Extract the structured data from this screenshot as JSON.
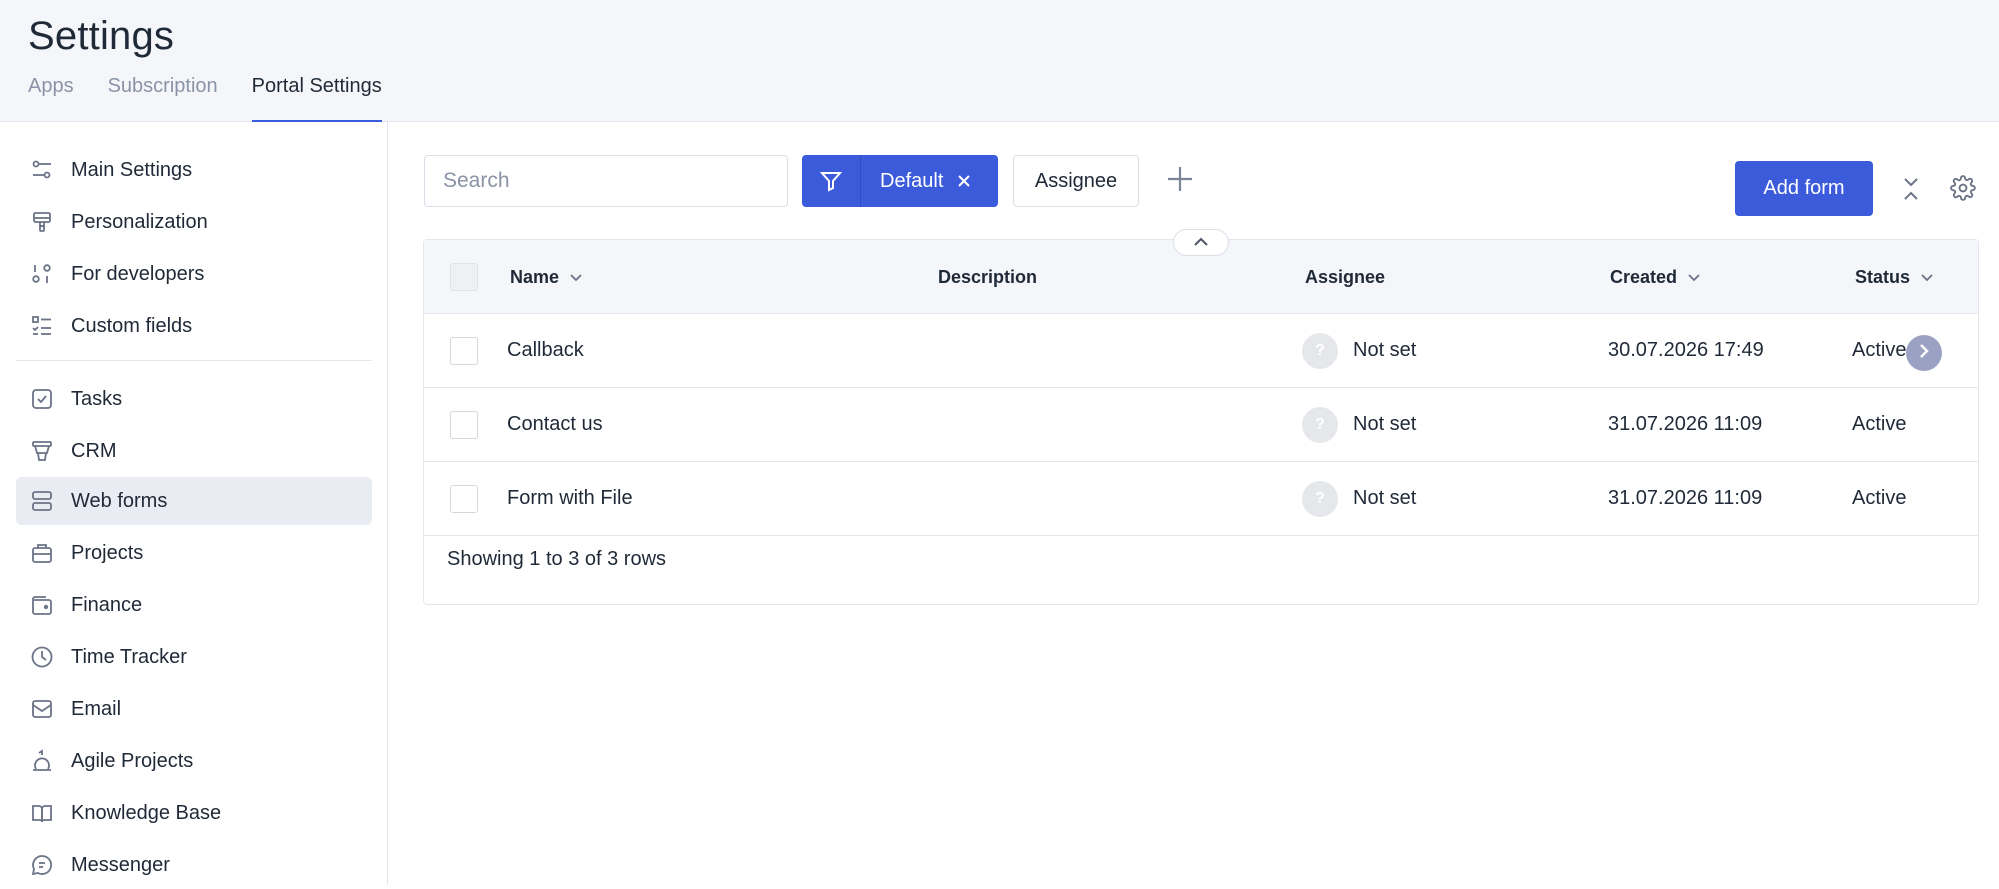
{
  "header": {
    "title": "Settings",
    "tabs": [
      {
        "label": "Apps",
        "active": false
      },
      {
        "label": "Subscription",
        "active": false
      },
      {
        "label": "Portal Settings",
        "active": true
      }
    ]
  },
  "sidebar": {
    "items": [
      {
        "label": "Main Settings",
        "icon": "sliders-icon"
      },
      {
        "label": "Personalization",
        "icon": "paint-brush-icon"
      },
      {
        "label": "For developers",
        "icon": "code-icon"
      },
      {
        "label": "Custom fields",
        "icon": "checklist-icon"
      },
      {
        "label": "Tasks",
        "icon": "checkbox-icon"
      },
      {
        "label": "CRM",
        "icon": "funnel-icon"
      },
      {
        "label": "Web forms",
        "icon": "form-icon",
        "active": true
      },
      {
        "label": "Projects",
        "icon": "briefcase-icon"
      },
      {
        "label": "Finance",
        "icon": "wallet-icon"
      },
      {
        "label": "Time Tracker",
        "icon": "clock-icon"
      },
      {
        "label": "Email",
        "icon": "envelope-icon"
      },
      {
        "label": "Agile Projects",
        "icon": "agile-icon"
      },
      {
        "label": "Knowledge Base",
        "icon": "book-icon"
      },
      {
        "label": "Messenger",
        "icon": "chat-icon"
      }
    ]
  },
  "toolbar": {
    "search_placeholder": "Search",
    "search_value": "",
    "filter_label": "Default",
    "assignee_label": "Assignee",
    "add_form_label": "Add form"
  },
  "table": {
    "columns": {
      "name": "Name",
      "description": "Description",
      "assignee": "Assignee",
      "created": "Created",
      "status": "Status"
    },
    "rows": [
      {
        "name": "Callback",
        "description": "",
        "assignee": "Not set",
        "avatar": "?",
        "created": "30.07.2026 17:49",
        "status": "Active"
      },
      {
        "name": "Contact us",
        "description": "",
        "assignee": "Not set",
        "avatar": "?",
        "created": "31.07.2026 11:09",
        "status": "Active"
      },
      {
        "name": "Form with File",
        "description": "",
        "assignee": "Not set",
        "avatar": "?",
        "created": "31.07.2026 11:09",
        "status": "Active"
      }
    ],
    "footer": "Showing 1 to 3 of 3 rows"
  },
  "colors": {
    "accent": "#3b5bdb",
    "sidebar_active_bg": "#e9ecf3",
    "header_bg": "#f5f6f9"
  }
}
